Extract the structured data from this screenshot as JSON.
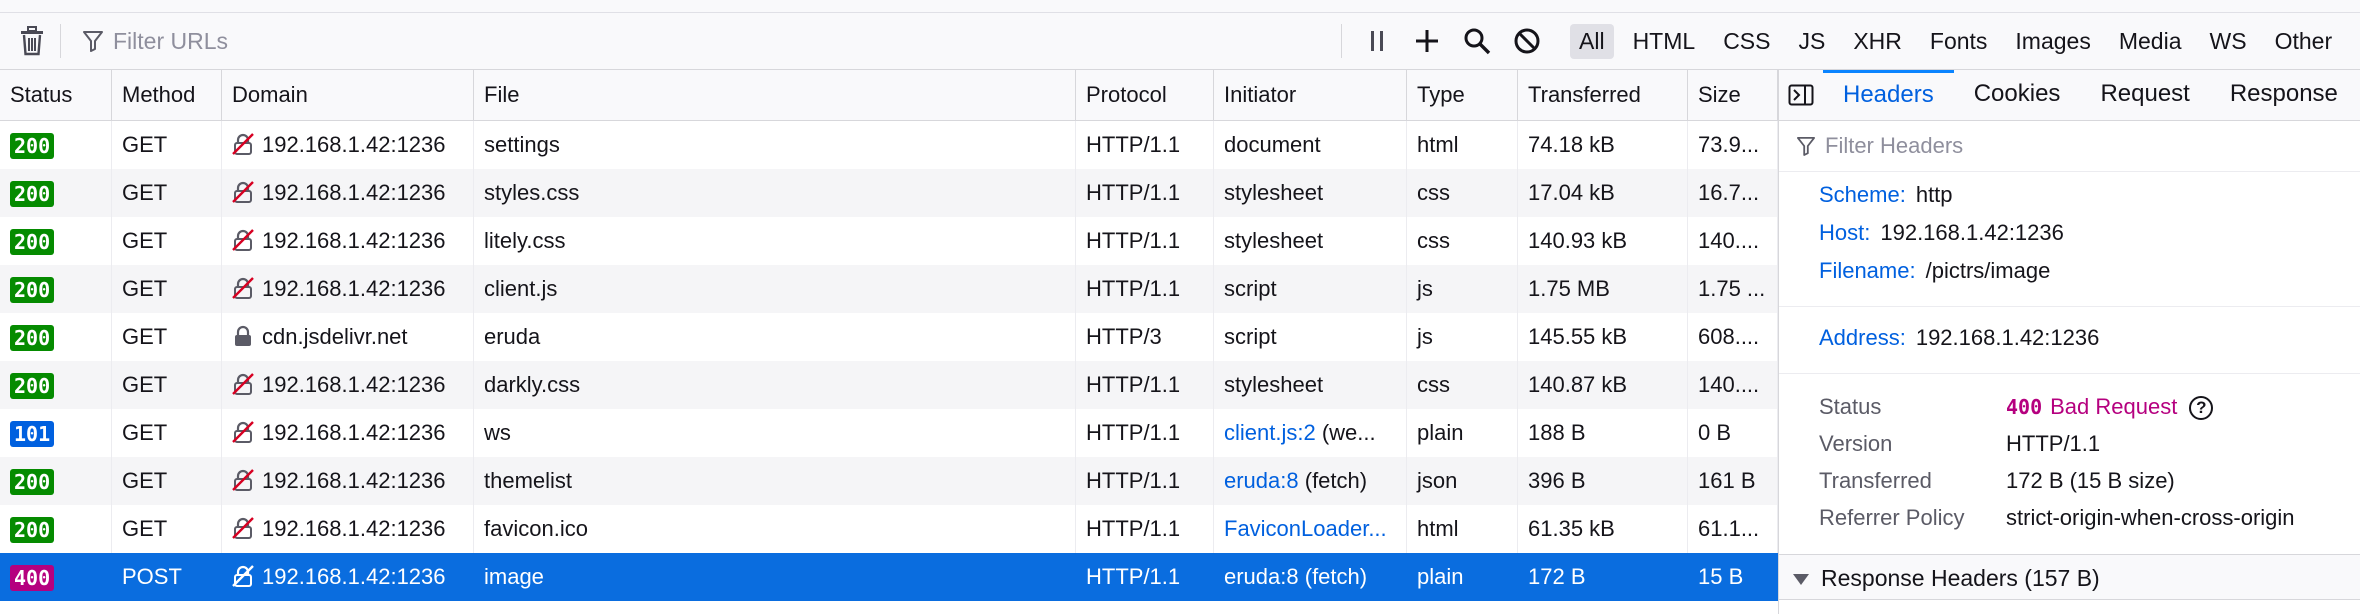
{
  "toolbar": {
    "filter_placeholder": "Filter URLs",
    "type_filters": [
      "All",
      "HTML",
      "CSS",
      "JS",
      "XHR",
      "Fonts",
      "Images",
      "Media",
      "WS",
      "Other"
    ]
  },
  "columns": [
    "Status",
    "Method",
    "Domain",
    "File",
    "Protocol",
    "Initiator",
    "Type",
    "Transferred",
    "Size"
  ],
  "rows": [
    {
      "status": "200",
      "method": "GET",
      "domain": "192.168.1.42:1236",
      "file": "settings",
      "protocol": "HTTP/1.1",
      "initiator": "document",
      "initiator_link": "",
      "type": "html",
      "transferred": "74.18 kB",
      "size": "73.9..."
    },
    {
      "status": "200",
      "method": "GET",
      "domain": "192.168.1.42:1236",
      "file": "styles.css",
      "protocol": "HTTP/1.1",
      "initiator": "stylesheet",
      "initiator_link": "",
      "type": "css",
      "transferred": "17.04 kB",
      "size": "16.7..."
    },
    {
      "status": "200",
      "method": "GET",
      "domain": "192.168.1.42:1236",
      "file": "litely.css",
      "protocol": "HTTP/1.1",
      "initiator": "stylesheet",
      "initiator_link": "",
      "type": "css",
      "transferred": "140.93 kB",
      "size": "140...."
    },
    {
      "status": "200",
      "method": "GET",
      "domain": "192.168.1.42:1236",
      "file": "client.js",
      "protocol": "HTTP/1.1",
      "initiator": "script",
      "initiator_link": "",
      "type": "js",
      "transferred": "1.75 MB",
      "size": "1.75 ..."
    },
    {
      "status": "200",
      "method": "GET",
      "domain": "cdn.jsdelivr.net",
      "file": "eruda",
      "protocol": "HTTP/3",
      "initiator": "script",
      "initiator_link": "",
      "type": "js",
      "transferred": "145.55 kB",
      "size": "608...."
    },
    {
      "status": "200",
      "method": "GET",
      "domain": "192.168.1.42:1236",
      "file": "darkly.css",
      "protocol": "HTTP/1.1",
      "initiator": "stylesheet",
      "initiator_link": "",
      "type": "css",
      "transferred": "140.87 kB",
      "size": "140...."
    },
    {
      "status": "101",
      "method": "GET",
      "domain": "192.168.1.42:1236",
      "file": "ws",
      "protocol": "HTTP/1.1",
      "initiator": " (we...",
      "initiator_link": "client.js:2",
      "type": "plain",
      "transferred": "188 B",
      "size": "0 B"
    },
    {
      "status": "200",
      "method": "GET",
      "domain": "192.168.1.42:1236",
      "file": "themelist",
      "protocol": "HTTP/1.1",
      "initiator": " (fetch)",
      "initiator_link": "eruda:8",
      "type": "json",
      "transferred": "396 B",
      "size": "161 B"
    },
    {
      "status": "200",
      "method": "GET",
      "domain": "192.168.1.42:1236",
      "file": "favicon.ico",
      "protocol": "HTTP/1.1",
      "initiator": "",
      "initiator_link": "FaviconLoader...",
      "type": "html",
      "transferred": "61.35 kB",
      "size": "61.1..."
    },
    {
      "status": "400",
      "method": "POST",
      "domain": "192.168.1.42:1236",
      "file": "image",
      "protocol": "HTTP/1.1",
      "initiator": " (fetch)",
      "initiator_link": "eruda:8",
      "type": "plain",
      "transferred": "172 B",
      "size": "15 B"
    }
  ],
  "status_colors": {
    "200": "#058b00",
    "101": "#0060df",
    "400": "#b5007f"
  },
  "domain_icons": {
    "192.168.1.42:1236": "insecure-lock-icon",
    "cdn.jsdelivr.net": "lock-icon"
  },
  "details": {
    "tabs": [
      "Headers",
      "Cookies",
      "Request",
      "Response"
    ],
    "filter_placeholder": "Filter Headers",
    "scheme_label": "Scheme:",
    "scheme": "http",
    "host_label": "Host:",
    "host": "192.168.1.42:1236",
    "filename_label": "Filename:",
    "filename": "/pictrs/image",
    "address_label": "Address:",
    "address": "192.168.1.42:1236",
    "status_label": "Status",
    "status_code": "400",
    "status_text": "Bad Request",
    "version_label": "Version",
    "version": "HTTP/1.1",
    "transferred_label": "Transferred",
    "transferred": "172 B (15 B size)",
    "referrer_label": "Referrer Policy",
    "referrer": "strict-origin-when-cross-origin",
    "response_headers": "Response Headers (157 B)"
  }
}
